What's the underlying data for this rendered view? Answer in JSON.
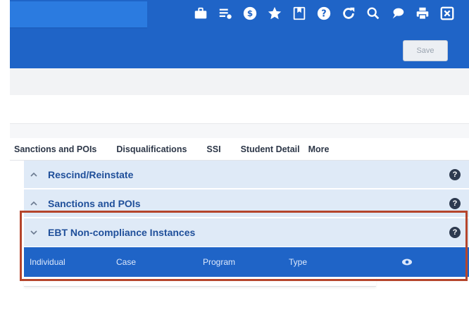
{
  "toolbar": {
    "icons": [
      "briefcase-icon",
      "list-icon",
      "dollar-icon",
      "star-icon",
      "bookmark-icon",
      "help-icon",
      "refresh-icon",
      "search-icon",
      "chat-icon",
      "print-icon",
      "close-window-icon"
    ],
    "save_label": "Save"
  },
  "tabs": [
    "Sanctions and POIs",
    "Disqualifications",
    "SSI",
    "Student Detail",
    "More"
  ],
  "sections": [
    {
      "title": "Rescind/Reinstate",
      "state": "collapsed",
      "help": "?"
    },
    {
      "title": "Sanctions and POIs",
      "state": "collapsed",
      "help": "?"
    },
    {
      "title": "EBT Non-compliance Instances",
      "state": "expanded",
      "help": "?"
    }
  ],
  "grid": {
    "columns": [
      "Individual",
      "Case",
      "Program",
      "Type"
    ],
    "action_icon": "eye-icon"
  },
  "colors": {
    "header_blue": "#1f64c7",
    "section_bg": "#dfeaf7",
    "section_title": "#1f4f9a",
    "highlight": "#b5452c"
  }
}
